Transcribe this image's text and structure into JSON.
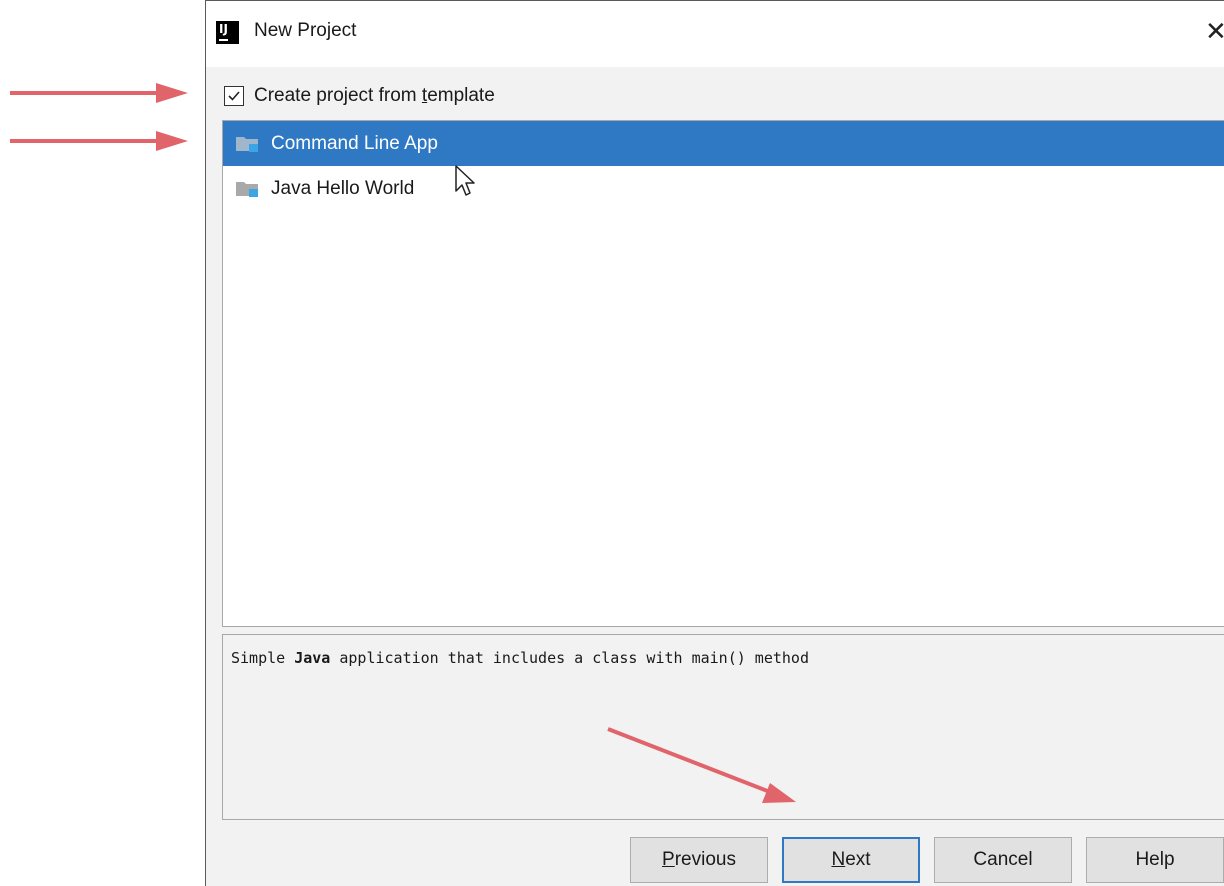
{
  "dialog": {
    "title": "New Project",
    "close_glyph": "✕"
  },
  "template_checkbox": {
    "label_before": "Create project from ",
    "label_mnemonic": "t",
    "label_after": "emplate",
    "checked": true
  },
  "templates": [
    {
      "label": "Command Line App",
      "selected": true,
      "icon": "folder-icon"
    },
    {
      "label": "Java Hello World",
      "selected": false,
      "icon": "folder-icon"
    }
  ],
  "description": {
    "before": "Simple ",
    "bold": "Java",
    "after": " application that includes a class with main() method"
  },
  "buttons": {
    "previous_mnemonic": "P",
    "previous_rest": "revious",
    "next_mnemonic": "N",
    "next_rest": "ext",
    "cancel": "Cancel",
    "help": "Help"
  },
  "colors": {
    "selection": "#2f79c4",
    "annotation_arrow": "#e0646a",
    "dialog_background": "#f2f2f2"
  }
}
